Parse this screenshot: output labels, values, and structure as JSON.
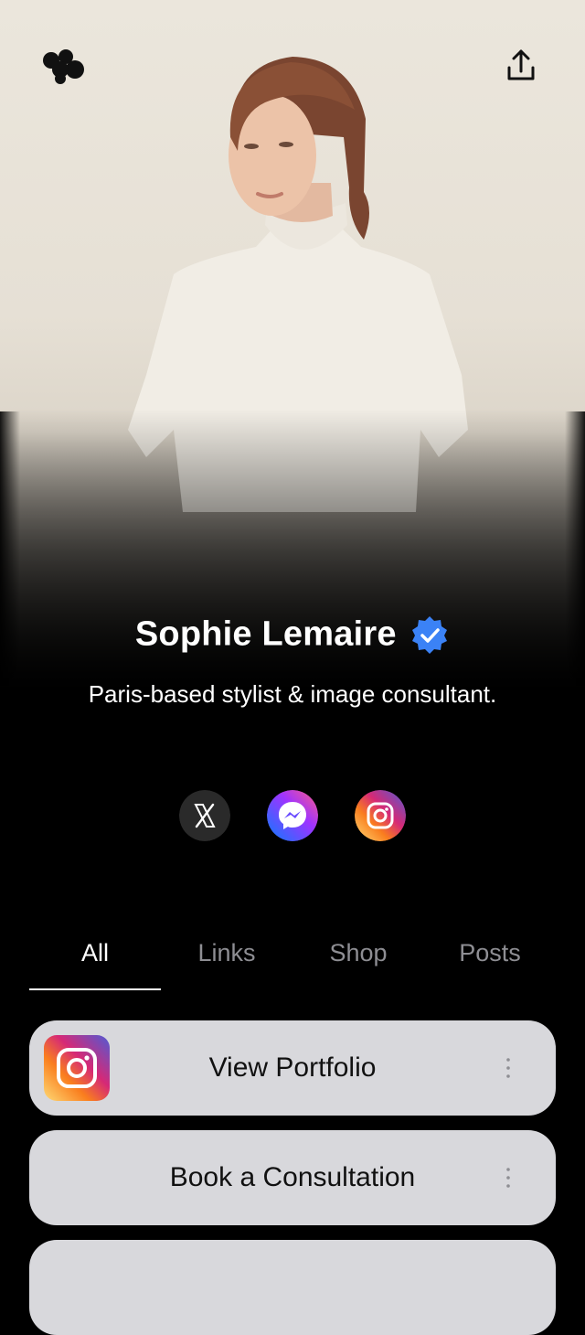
{
  "header": {
    "logo_icon": "linktree-blob-logo",
    "share_icon": "share-upload-icon"
  },
  "profile": {
    "name": "Sophie Lemaire",
    "verified_icon": "verified-badge-icon",
    "verified_color": "#3b82f6",
    "bio": "Paris-based stylist & image consultant."
  },
  "socials": [
    {
      "name": "x",
      "icon": "x-icon"
    },
    {
      "name": "messenger",
      "icon": "messenger-icon"
    },
    {
      "name": "instagram",
      "icon": "instagram-icon"
    }
  ],
  "tabs": [
    {
      "label": "All",
      "active": true
    },
    {
      "label": "Links",
      "active": false
    },
    {
      "label": "Shop",
      "active": false
    },
    {
      "label": "Posts",
      "active": false
    }
  ],
  "links": [
    {
      "label": "View Portfolio",
      "thumbnail_icon": "instagram-icon",
      "more_icon": "more-vertical-icon"
    },
    {
      "label": "Book a Consultation",
      "more_icon": "more-vertical-icon"
    },
    {
      "label": ""
    }
  ],
  "colors": {
    "background": "#000000",
    "card": "#d8d8dc",
    "tab_inactive": "#8e8e93"
  }
}
